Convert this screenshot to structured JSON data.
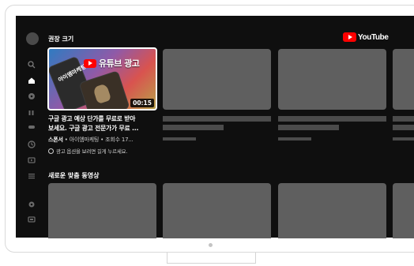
{
  "sections": {
    "recommended_title": "권장 크기",
    "new_videos_title": "새로운 맞춤 동영상"
  },
  "brand": {
    "logo_text": "YouTube",
    "red": "#ff0000"
  },
  "featured_video": {
    "thumbnail_banner": "유튜브 광고",
    "phone_label": "아이엠마케팅",
    "duration": "00:15",
    "title_line1": "구글 광고 예상 단가를 무료로 받아",
    "title_line2": "보세요. 구글 광고 전문가가 무료 ...",
    "sponsor_label": "스폰서",
    "meta": " • 아이엠마케팅 • 조회수 17...",
    "notice": "광고 옵션을 보려면 길게 누르세요."
  },
  "sidebar": {
    "icons": [
      "search-icon",
      "home-icon",
      "explore-icon",
      "subscriptions-icon",
      "gaming-icon",
      "library-icon",
      "video-icon",
      "menu-icon",
      "settings-icon",
      "account-switch-icon"
    ]
  },
  "colors": {
    "screen_bg": "#0f0f0f",
    "placeholder": "#5f5f5f",
    "placeholder_bar": "#4b4b4b"
  }
}
